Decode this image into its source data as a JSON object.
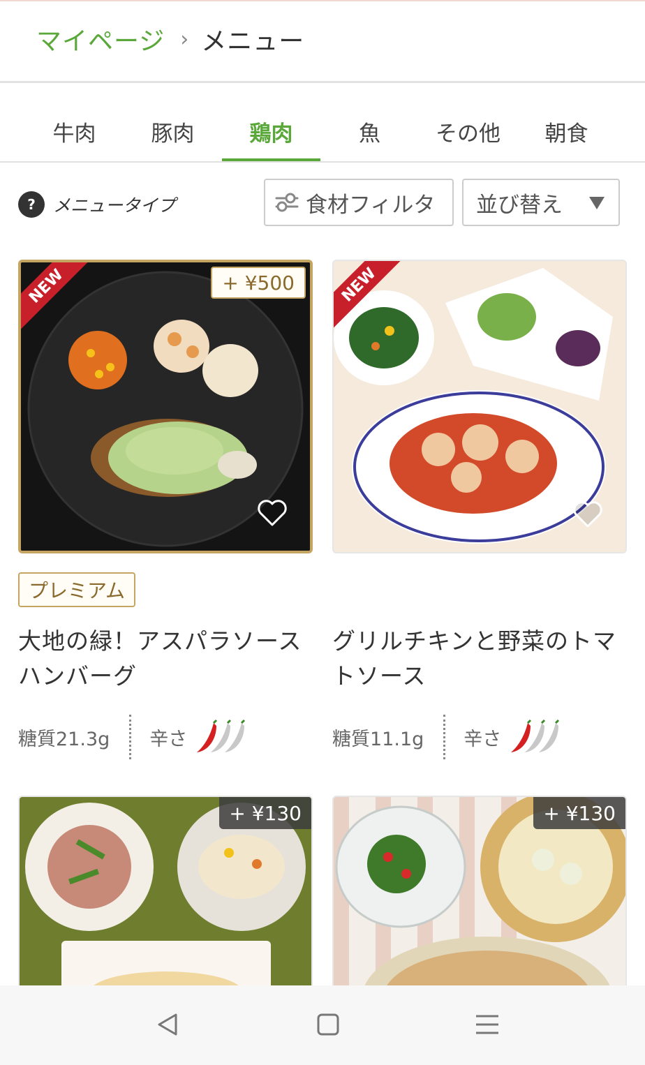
{
  "breadcrumb": {
    "parent": "マイページ",
    "separator": "›",
    "current": "メニュー"
  },
  "tabs": [
    {
      "label": "牛肉",
      "active": false
    },
    {
      "label": "豚肉",
      "active": false
    },
    {
      "label": "鶏肉",
      "active": true
    },
    {
      "label": "魚",
      "active": false
    },
    {
      "label": "その他",
      "active": false
    },
    {
      "label": "朝食",
      "active": false
    }
  ],
  "toolbar": {
    "help_icon": "?",
    "menu_type_label": "メニュータイプ",
    "filter_label": "食材フィルタ",
    "sort_label": "並び替え"
  },
  "cards": [
    {
      "badge_new": "NEW",
      "price": "+ ¥500",
      "premium_label": "プレミアム",
      "name": "大地の緑！アスパラソースハンバーグ",
      "carbs": "糖質21.3g",
      "spice_label": "辛さ",
      "spice_level": 1,
      "spice_max": 3
    },
    {
      "badge_new": "NEW",
      "name": "グリルチキンと野菜のトマトソース",
      "carbs": "糖質11.1g",
      "spice_label": "辛さ",
      "spice_level": 1,
      "spice_max": 3
    },
    {
      "price": "+ ¥130"
    },
    {
      "price": "+ ¥130"
    }
  ],
  "colors": {
    "accent": "#5aa83a",
    "premium_gold": "#c5a562",
    "ribbon_red": "#c8202a",
    "chili_red": "#d42020"
  },
  "icons": [
    "help-icon",
    "filter-icon",
    "caret-down-icon",
    "heart-icon",
    "chili-icon",
    "back-icon",
    "home-icon",
    "menu-icon"
  ]
}
